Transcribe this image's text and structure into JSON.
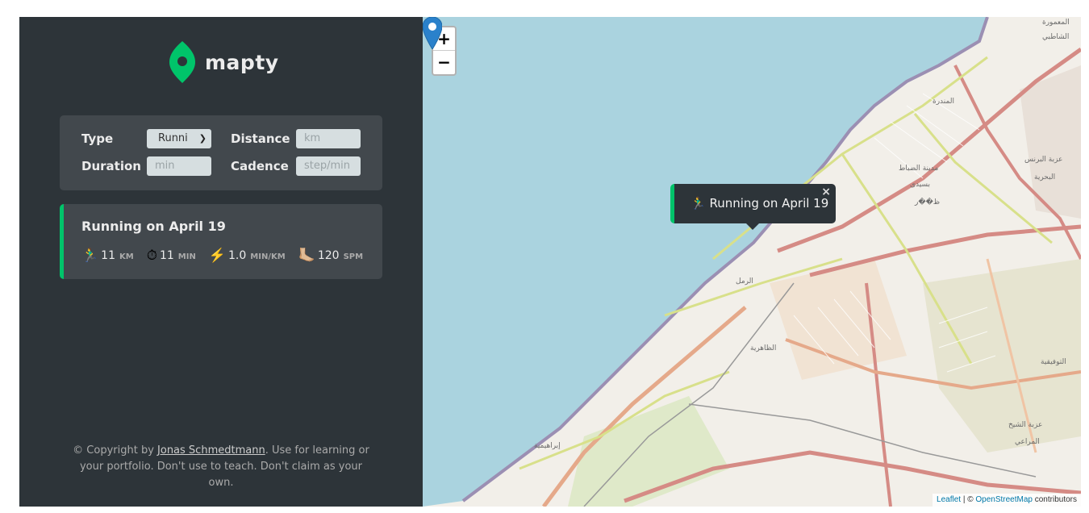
{
  "logo": {
    "text": "mapty",
    "icon": "map-pin-icon",
    "brand_color": "#00c46a"
  },
  "form": {
    "type_label": "Type",
    "type_value": "Runni",
    "distance_label": "Distance",
    "distance_placeholder": "km",
    "duration_label": "Duration",
    "duration_placeholder": "min",
    "cadence_label": "Cadence",
    "cadence_placeholder": "step/min"
  },
  "workouts": [
    {
      "title": "Running on April 19",
      "details": [
        {
          "icon": "🏃‍♂️",
          "value": "11",
          "unit": "KM"
        },
        {
          "icon": "⏱",
          "value": "11",
          "unit": "MIN"
        },
        {
          "icon": "⚡️",
          "value": "1.0",
          "unit": "MIN/KM"
        },
        {
          "icon": "🦶🏼",
          "value": "120",
          "unit": "SPM"
        }
      ]
    }
  ],
  "copyright": {
    "prefix": "© Copyright by ",
    "author": "Jonas Schmedtmann",
    "suffix": ". Use for learning or your portfolio. Don't use to teach. Don't claim as your own."
  },
  "map": {
    "zoom_in": "+",
    "zoom_out": "−",
    "popup_text": "🏃‍♂️ Running on April 19",
    "popup_close": "×",
    "attribution": {
      "leaflet": "Leaflet",
      "sep": " | © ",
      "osm": "OpenStreetMap",
      "suffix": " contributors"
    },
    "labels": [
      "المعمورة",
      "الشاطبي",
      "عزبة البرنس",
      "البحرية",
      "مدينة الضباط",
      "بسيدى",
      "ظ��ر",
      "الظاهرية",
      "إبراهيمية",
      "عزبة الشيخ",
      "المراعي",
      "التوفيقية",
      "المندرة",
      "الرمل"
    ],
    "water_color": "#aad3df"
  }
}
